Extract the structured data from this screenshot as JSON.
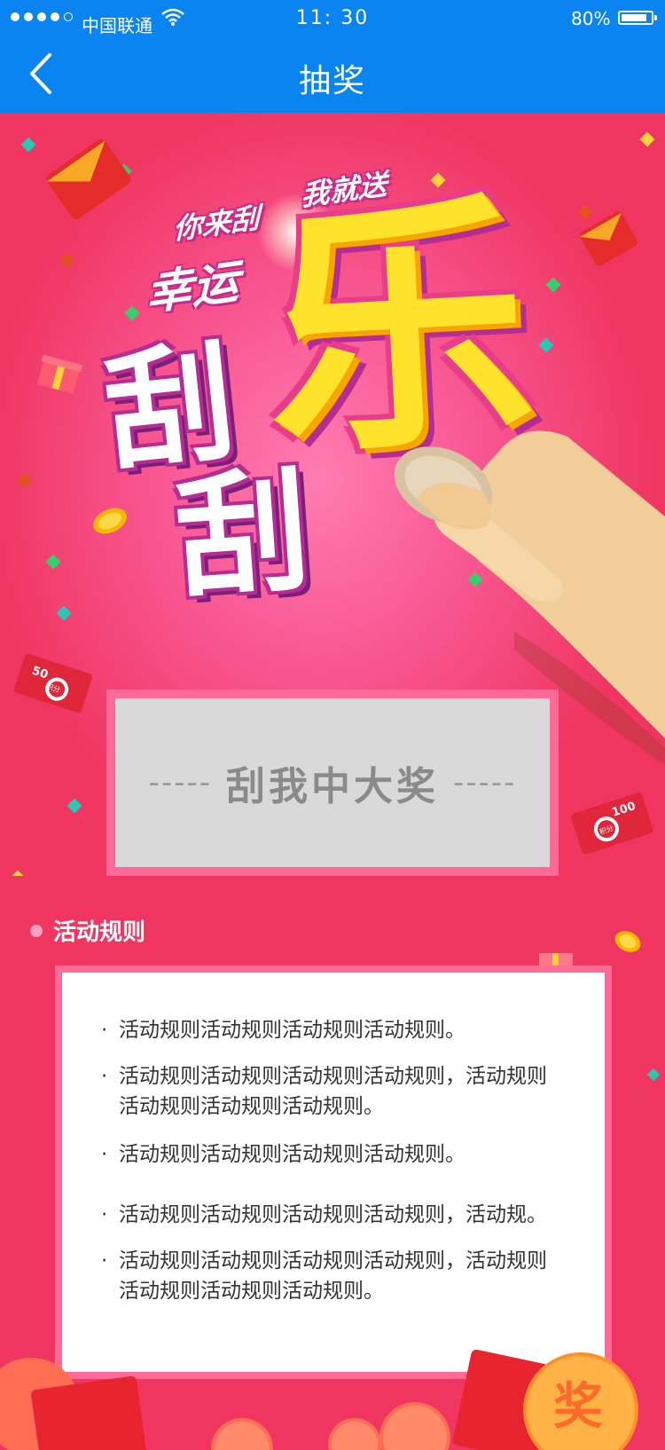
{
  "status_bar": {
    "carrier": "中国联通",
    "time": "11: 30",
    "battery": "80%"
  },
  "nav": {
    "title": "抽奖",
    "back_icon": "chevron-left-icon"
  },
  "hero": {
    "slogan_1": "你来刮",
    "slogan_2": "我就送",
    "slogan_3": "幸运",
    "big_char_1": "刮",
    "big_char_2": "刮",
    "big_char_3": "乐"
  },
  "scratch_card": {
    "dash_left": "-----",
    "label": "刮我中大奖",
    "dash_right": "-----"
  },
  "rules": {
    "title": "活动规则",
    "items": [
      "活动规则活动规则活动规则活动规则。",
      "活动规则活动规则活动规则活动规则，活动规则活动规则活动规则活动规则。",
      "活动规则活动规则活动规则活动规则。",
      "活动规则活动规则活动规则活动规则，活动规。",
      "活动规则活动规则活动规则活动规则，活动规则活动规则活动规则活动规则。"
    ]
  },
  "decorations": {
    "note_50": "50",
    "note_100": "100",
    "note_label": "积分",
    "prize_char": "奖"
  },
  "colors": {
    "nav_blue": "#0a84f0",
    "bg_pink": "#ef3560",
    "frame_pink": "#ff6b96",
    "accent_yellow": "#ffe22b"
  }
}
